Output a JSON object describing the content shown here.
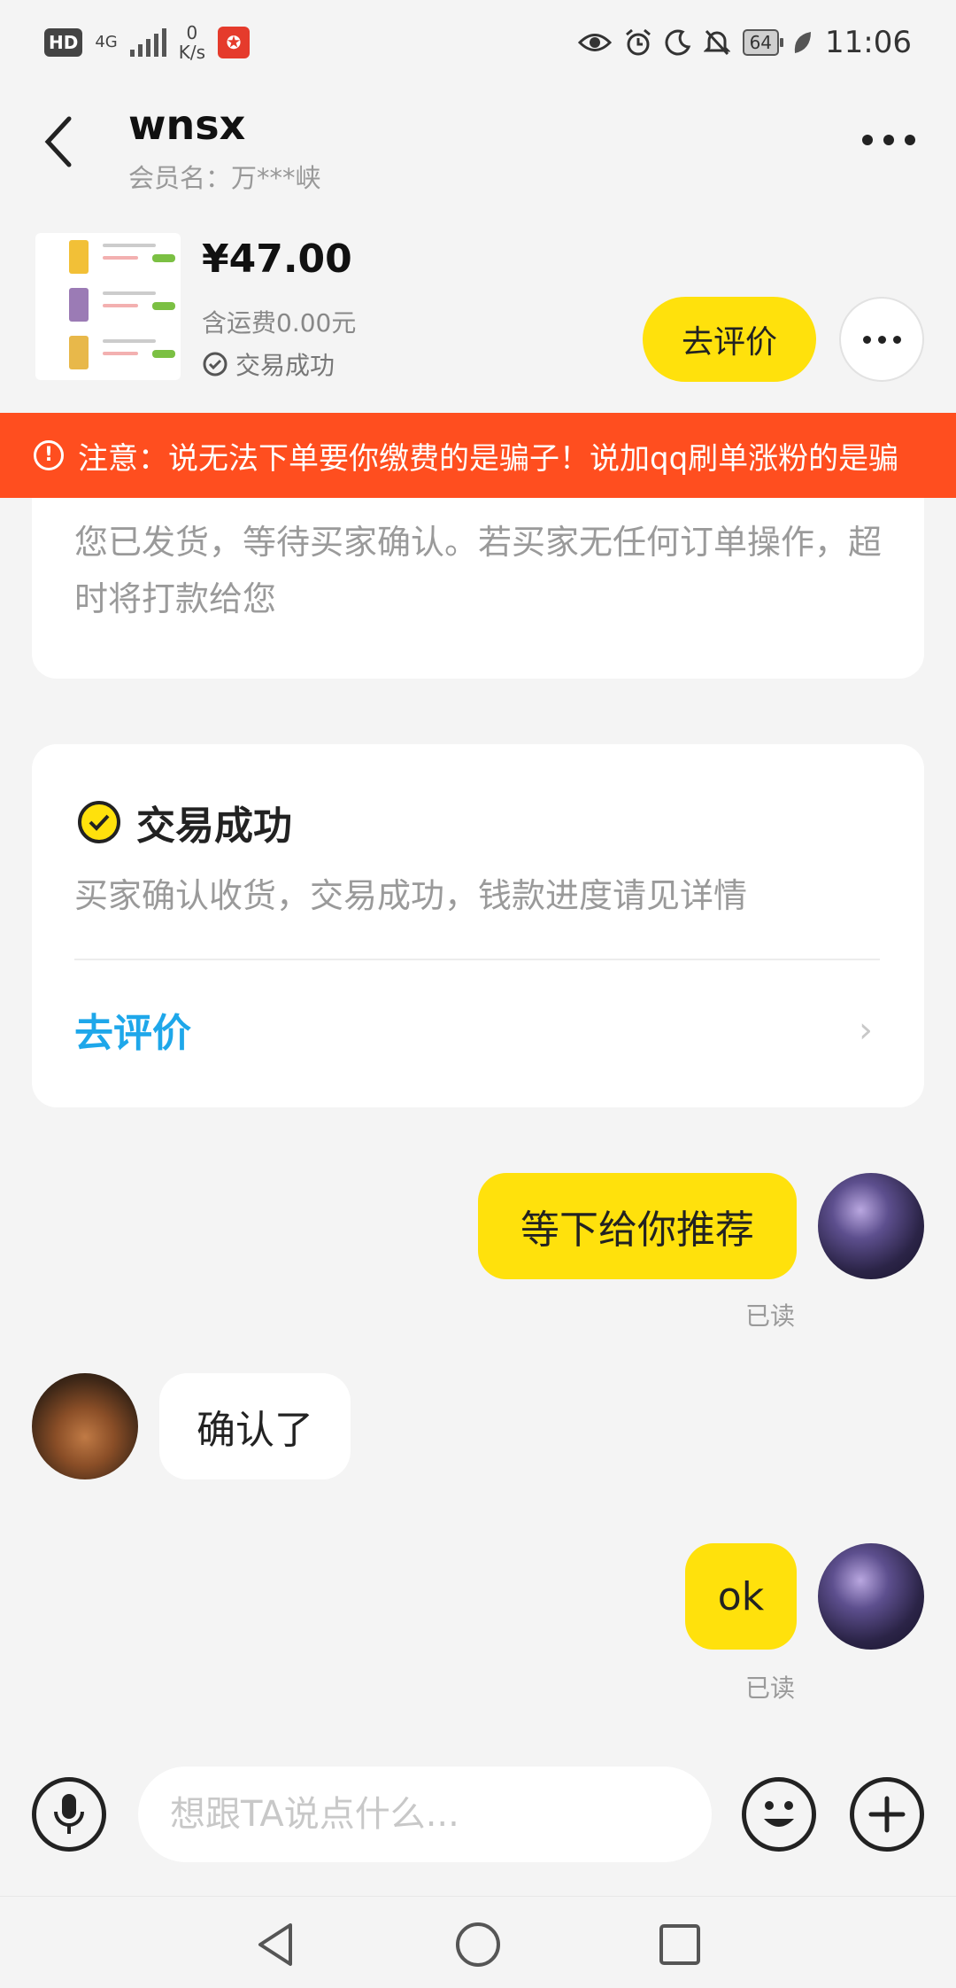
{
  "status_bar": {
    "hd": "HD",
    "network": "4G",
    "speed_value": "0",
    "speed_unit": "K/s",
    "battery": "64",
    "time": "11:06"
  },
  "header": {
    "title": "wnsx",
    "subtitle": "会员名：万***峡"
  },
  "product": {
    "price": "¥47.00",
    "shipping": "含运费0.00元",
    "status": "交易成功",
    "review_button": "去评价"
  },
  "warning": {
    "text": "注意：说无法下单要你缴费的是骗子！说加qq刷单涨粉的是骗"
  },
  "shipped_card": {
    "text": "您已发货，等待买家确认。若买家无任何订单操作，超时将打款给您"
  },
  "success_card": {
    "title": "交易成功",
    "description": "买家确认收货，交易成功，钱款进度请见详情",
    "link": "去评价"
  },
  "messages": [
    {
      "from": "me",
      "text": "等下给你推荐",
      "read": "已读"
    },
    {
      "from": "other",
      "text": "确认了"
    },
    {
      "from": "me",
      "text": "ok",
      "read": "已读"
    }
  ],
  "input": {
    "placeholder": "想跟TA说点什么..."
  },
  "colors": {
    "accent_yellow": "#ffe10c",
    "warning_red": "#ff4e1f",
    "link_blue": "#1ea7ea"
  }
}
